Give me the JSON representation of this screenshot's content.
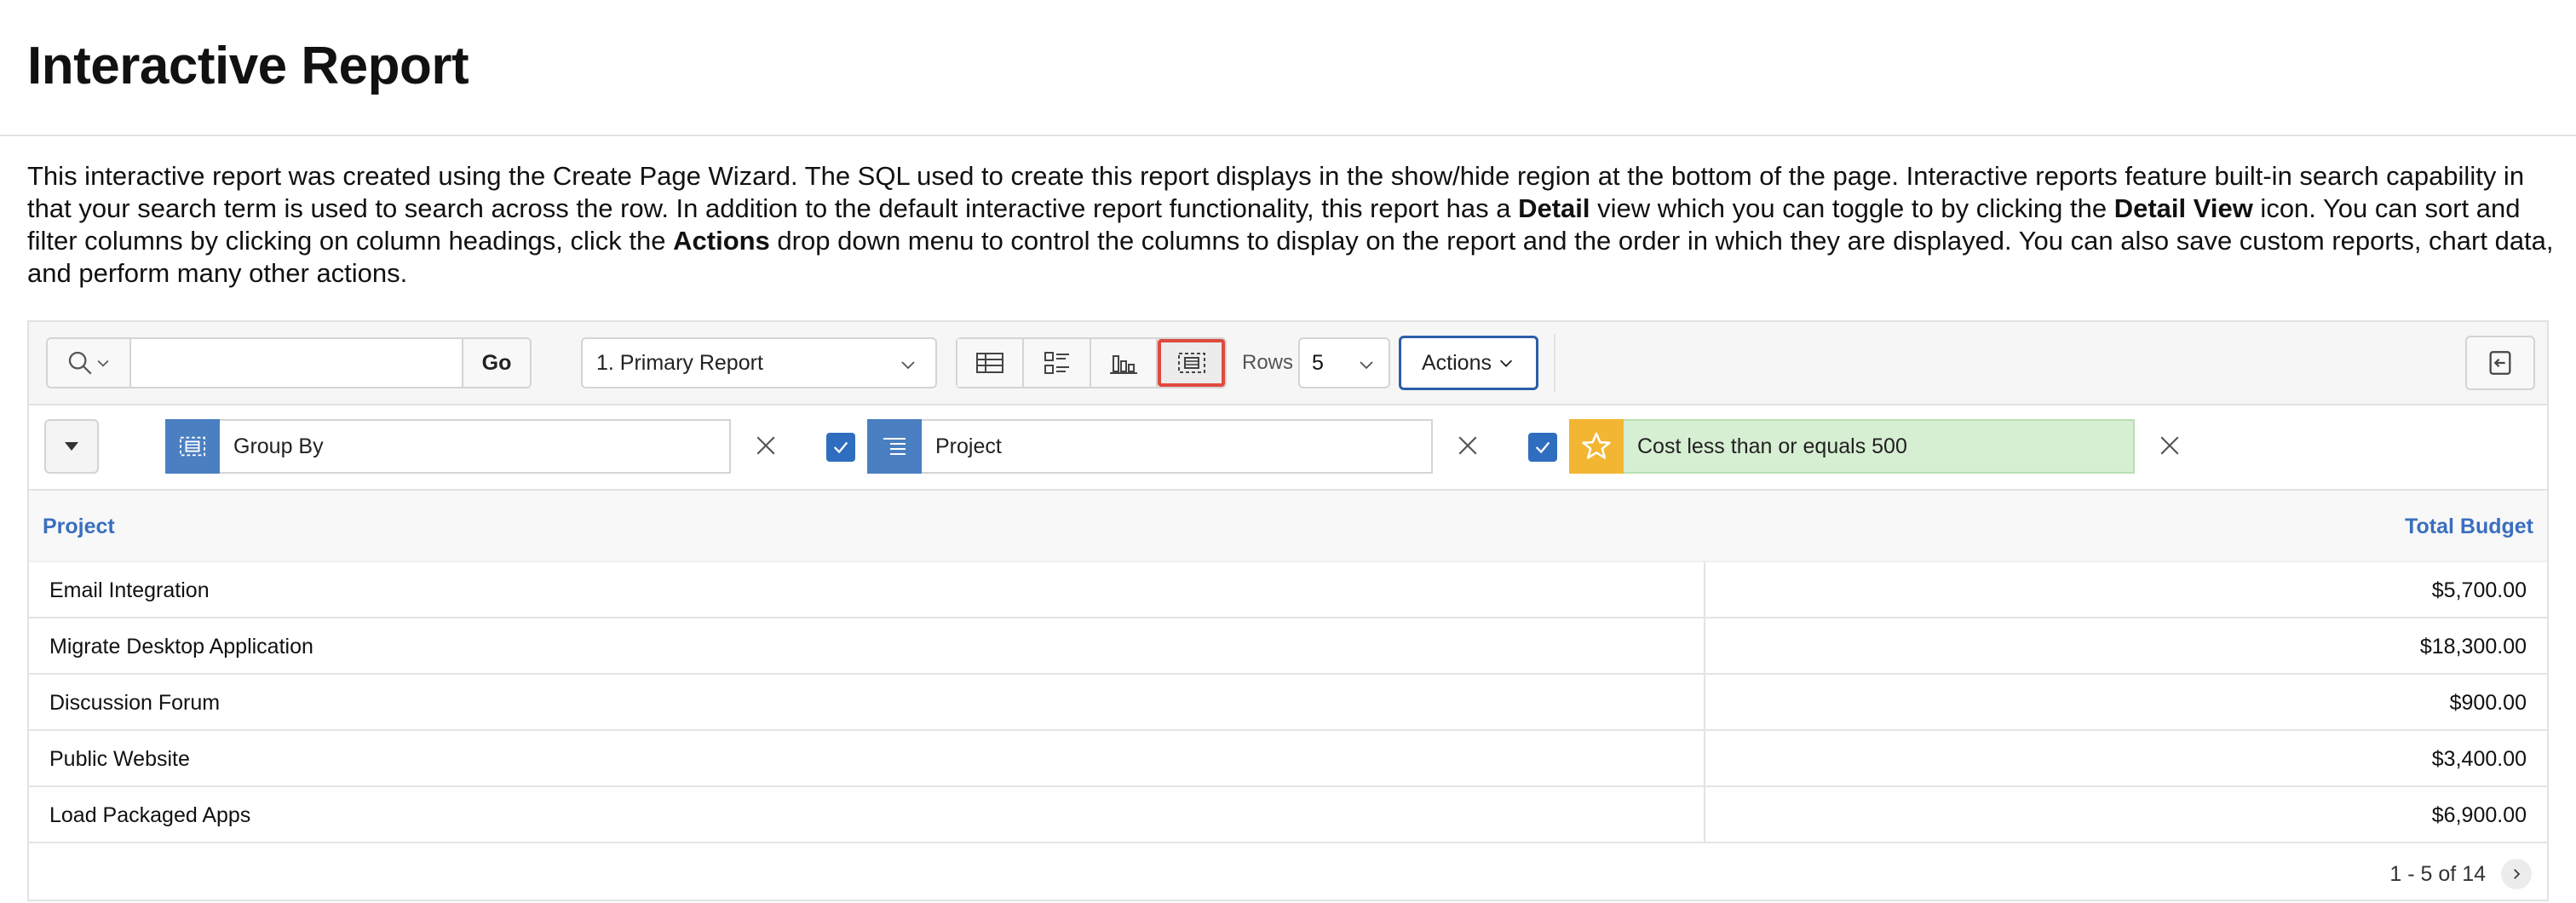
{
  "page": {
    "title": "Interactive Report"
  },
  "intro": {
    "s1": "This interactive report was created using the Create Page Wizard. The SQL used to create this report displays in the show/hide region at the bottom of the page. Interactive reports feature built-in search capability in that your search term is used to search across the row. In addition to the default interactive report functionality, this report has a ",
    "b1": "Detail",
    "s2": " view which you can toggle to by clicking the ",
    "b2": "Detail View",
    "s3": " icon. You can sort and filter columns by clicking on column headings, click the ",
    "b3": "Actions",
    "s4": " drop down menu to control the columns to display on the report and the order in which they are displayed. You can also save custom reports, chart data, and perform many other actions."
  },
  "toolbar": {
    "search_value": "",
    "go_label": "Go",
    "report_selected": "1. Primary Report",
    "rows_label": "Rows",
    "rows_value": "5",
    "actions_label": "Actions",
    "views": [
      "grid-view-icon",
      "detail-view-icon",
      "chart-view-icon",
      "group-by-view-icon"
    ],
    "active_view": "group-by-view-icon",
    "active_outline_color": "#e04a3f"
  },
  "filters": [
    {
      "type": "group-by",
      "label": "Group By",
      "icon": "group-by-icon",
      "color": "#4a7fc1",
      "checked": null
    },
    {
      "type": "group-by-column",
      "label": "Project",
      "icon": "align-right-icon",
      "color": "#4a7fc1",
      "checked": true
    },
    {
      "type": "highlight",
      "label": "Cost less than or equals 500",
      "icon": "star-icon",
      "color": "#f3b633",
      "highlight_bg": "#d6eed2",
      "checked": true
    }
  ],
  "table": {
    "columns": [
      "Project",
      "Total Budget"
    ],
    "rows": [
      {
        "project": "Email Integration",
        "budget": "$5,700.00"
      },
      {
        "project": "Migrate Desktop Application",
        "budget": "$18,300.00"
      },
      {
        "project": "Discussion Forum",
        "budget": "$900.00"
      },
      {
        "project": "Public Website",
        "budget": "$3,400.00"
      },
      {
        "project": "Load Packaged Apps",
        "budget": "$6,900.00"
      }
    ],
    "pagination": "1 - 5 of 14"
  }
}
